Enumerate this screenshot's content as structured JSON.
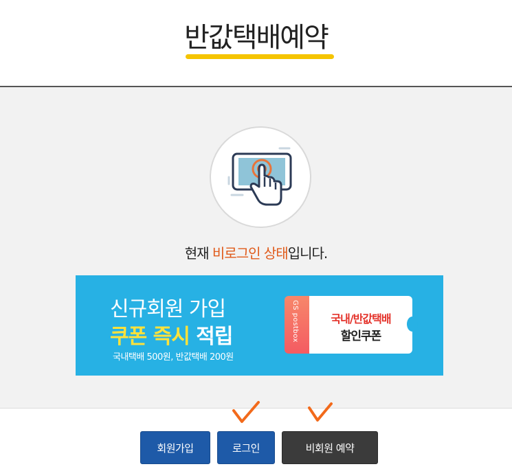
{
  "header": {
    "title": "반값택배예약"
  },
  "status": {
    "prefix": "현재 ",
    "highlight": "비로그인 상태",
    "suffix": "입니다."
  },
  "banner": {
    "line1": "신규회원 가입",
    "line2_highlight": "쿠폰 즉시",
    "line2_rest": " 적립",
    "line3": "국내택배 500원, 반값택배 200원",
    "coupon": {
      "brand": "GS postbox",
      "line1": "국내/반값택배",
      "line2": "할인쿠폰"
    }
  },
  "buttons": {
    "signup": "회원가입",
    "login": "로그인",
    "guest_booking": "비회원 예약"
  },
  "colors": {
    "accent_orange": "#e05a1a",
    "title_underline": "#f5c400",
    "banner_blue": "#27b1e4",
    "button_blue": "#1e5aa8",
    "button_dark": "#3b3b3b",
    "check_mark": "#f26a1b"
  },
  "icons": {
    "status_icon": "tablet-touch-icon",
    "annotation": "check-mark-icon"
  }
}
